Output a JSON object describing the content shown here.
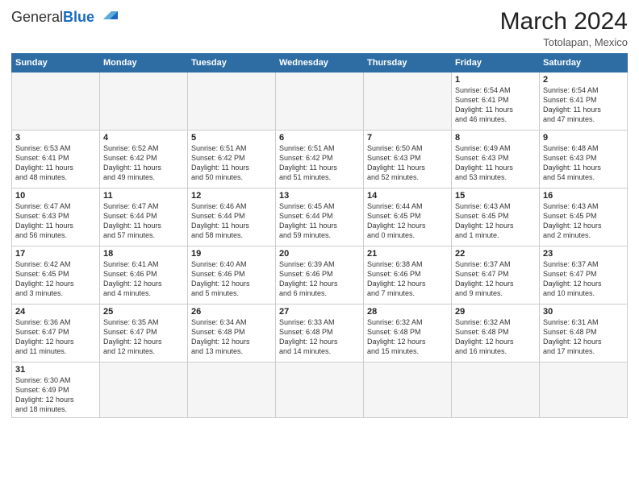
{
  "logo": {
    "text_general": "General",
    "text_blue": "Blue"
  },
  "header": {
    "title": "March 2024",
    "subtitle": "Totolapan, Mexico"
  },
  "weekdays": [
    "Sunday",
    "Monday",
    "Tuesday",
    "Wednesday",
    "Thursday",
    "Friday",
    "Saturday"
  ],
  "weeks": [
    [
      {
        "day": "",
        "info": "",
        "empty": true
      },
      {
        "day": "",
        "info": "",
        "empty": true
      },
      {
        "day": "",
        "info": "",
        "empty": true
      },
      {
        "day": "",
        "info": "",
        "empty": true
      },
      {
        "day": "",
        "info": "",
        "empty": true
      },
      {
        "day": "1",
        "info": "Sunrise: 6:54 AM\nSunset: 6:41 PM\nDaylight: 11 hours\nand 46 minutes."
      },
      {
        "day": "2",
        "info": "Sunrise: 6:54 AM\nSunset: 6:41 PM\nDaylight: 11 hours\nand 47 minutes."
      }
    ],
    [
      {
        "day": "3",
        "info": "Sunrise: 6:53 AM\nSunset: 6:41 PM\nDaylight: 11 hours\nand 48 minutes."
      },
      {
        "day": "4",
        "info": "Sunrise: 6:52 AM\nSunset: 6:42 PM\nDaylight: 11 hours\nand 49 minutes."
      },
      {
        "day": "5",
        "info": "Sunrise: 6:51 AM\nSunset: 6:42 PM\nDaylight: 11 hours\nand 50 minutes."
      },
      {
        "day": "6",
        "info": "Sunrise: 6:51 AM\nSunset: 6:42 PM\nDaylight: 11 hours\nand 51 minutes."
      },
      {
        "day": "7",
        "info": "Sunrise: 6:50 AM\nSunset: 6:43 PM\nDaylight: 11 hours\nand 52 minutes."
      },
      {
        "day": "8",
        "info": "Sunrise: 6:49 AM\nSunset: 6:43 PM\nDaylight: 11 hours\nand 53 minutes."
      },
      {
        "day": "9",
        "info": "Sunrise: 6:48 AM\nSunset: 6:43 PM\nDaylight: 11 hours\nand 54 minutes."
      }
    ],
    [
      {
        "day": "10",
        "info": "Sunrise: 6:47 AM\nSunset: 6:43 PM\nDaylight: 11 hours\nand 56 minutes."
      },
      {
        "day": "11",
        "info": "Sunrise: 6:47 AM\nSunset: 6:44 PM\nDaylight: 11 hours\nand 57 minutes."
      },
      {
        "day": "12",
        "info": "Sunrise: 6:46 AM\nSunset: 6:44 PM\nDaylight: 11 hours\nand 58 minutes."
      },
      {
        "day": "13",
        "info": "Sunrise: 6:45 AM\nSunset: 6:44 PM\nDaylight: 11 hours\nand 59 minutes."
      },
      {
        "day": "14",
        "info": "Sunrise: 6:44 AM\nSunset: 6:45 PM\nDaylight: 12 hours\nand 0 minutes."
      },
      {
        "day": "15",
        "info": "Sunrise: 6:43 AM\nSunset: 6:45 PM\nDaylight: 12 hours\nand 1 minute."
      },
      {
        "day": "16",
        "info": "Sunrise: 6:43 AM\nSunset: 6:45 PM\nDaylight: 12 hours\nand 2 minutes."
      }
    ],
    [
      {
        "day": "17",
        "info": "Sunrise: 6:42 AM\nSunset: 6:45 PM\nDaylight: 12 hours\nand 3 minutes."
      },
      {
        "day": "18",
        "info": "Sunrise: 6:41 AM\nSunset: 6:46 PM\nDaylight: 12 hours\nand 4 minutes."
      },
      {
        "day": "19",
        "info": "Sunrise: 6:40 AM\nSunset: 6:46 PM\nDaylight: 12 hours\nand 5 minutes."
      },
      {
        "day": "20",
        "info": "Sunrise: 6:39 AM\nSunset: 6:46 PM\nDaylight: 12 hours\nand 6 minutes."
      },
      {
        "day": "21",
        "info": "Sunrise: 6:38 AM\nSunset: 6:46 PM\nDaylight: 12 hours\nand 7 minutes."
      },
      {
        "day": "22",
        "info": "Sunrise: 6:37 AM\nSunset: 6:47 PM\nDaylight: 12 hours\nand 9 minutes."
      },
      {
        "day": "23",
        "info": "Sunrise: 6:37 AM\nSunset: 6:47 PM\nDaylight: 12 hours\nand 10 minutes."
      }
    ],
    [
      {
        "day": "24",
        "info": "Sunrise: 6:36 AM\nSunset: 6:47 PM\nDaylight: 12 hours\nand 11 minutes."
      },
      {
        "day": "25",
        "info": "Sunrise: 6:35 AM\nSunset: 6:47 PM\nDaylight: 12 hours\nand 12 minutes."
      },
      {
        "day": "26",
        "info": "Sunrise: 6:34 AM\nSunset: 6:48 PM\nDaylight: 12 hours\nand 13 minutes."
      },
      {
        "day": "27",
        "info": "Sunrise: 6:33 AM\nSunset: 6:48 PM\nDaylight: 12 hours\nand 14 minutes."
      },
      {
        "day": "28",
        "info": "Sunrise: 6:32 AM\nSunset: 6:48 PM\nDaylight: 12 hours\nand 15 minutes."
      },
      {
        "day": "29",
        "info": "Sunrise: 6:32 AM\nSunset: 6:48 PM\nDaylight: 12 hours\nand 16 minutes."
      },
      {
        "day": "30",
        "info": "Sunrise: 6:31 AM\nSunset: 6:48 PM\nDaylight: 12 hours\nand 17 minutes."
      }
    ],
    [
      {
        "day": "31",
        "info": "Sunrise: 6:30 AM\nSunset: 6:49 PM\nDaylight: 12 hours\nand 18 minutes.",
        "last": true
      },
      {
        "day": "",
        "info": "",
        "empty": true,
        "last": true
      },
      {
        "day": "",
        "info": "",
        "empty": true,
        "last": true
      },
      {
        "day": "",
        "info": "",
        "empty": true,
        "last": true
      },
      {
        "day": "",
        "info": "",
        "empty": true,
        "last": true
      },
      {
        "day": "",
        "info": "",
        "empty": true,
        "last": true
      },
      {
        "day": "",
        "info": "",
        "empty": true,
        "last": true
      }
    ]
  ]
}
